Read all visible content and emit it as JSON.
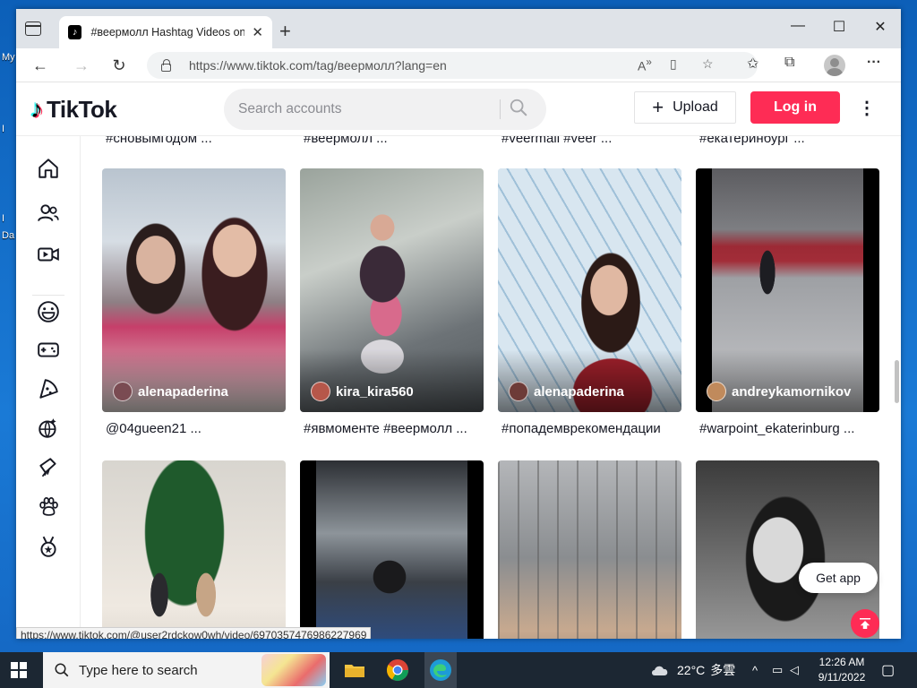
{
  "desktop": {
    "labels": [
      "My",
      "I",
      "I",
      "Da"
    ]
  },
  "browser": {
    "tab_title": "#веермолл Hashtag Videos on TikTok",
    "url": "https://www.tiktok.com/tag/веермолл?lang=en",
    "status_url": "https://www.tiktok.com/@user2rdckow0wh/video/6970357476986227969"
  },
  "tiktok": {
    "logo_text": "TikTok",
    "search_placeholder": "Search accounts",
    "upload_label": "Upload",
    "login_label": "Log in",
    "get_app_label": "Get app",
    "brand_color": "#fe2c55",
    "top_captions": [
      "#сновымгодом ...",
      "#веермолл ...",
      "#veermall #veer ...",
      "#екатеринбург ..."
    ],
    "row1": [
      {
        "user": "alenapaderina",
        "caption": "@04gueen21 ..."
      },
      {
        "user": "kira_kira560",
        "caption": "#явмоменте #веермолл ..."
      },
      {
        "user": "alenapaderina",
        "caption": "#попадемврекомендации"
      },
      {
        "user": "andreykamornikov",
        "caption": "#warpoint_ekaterinburg ..."
      }
    ],
    "sidebar_icons": [
      "home-icon",
      "following-icon",
      "live-icon",
      "comedy-icon",
      "gaming-icon",
      "food-icon",
      "dance-icon",
      "beauty-icon",
      "animals-icon",
      "sports-icon"
    ]
  },
  "taskbar": {
    "search_text": "Type here to search",
    "temperature": "22°C",
    "weather_text": "多雲",
    "time": "12:26 AM",
    "date": "9/11/2022"
  }
}
